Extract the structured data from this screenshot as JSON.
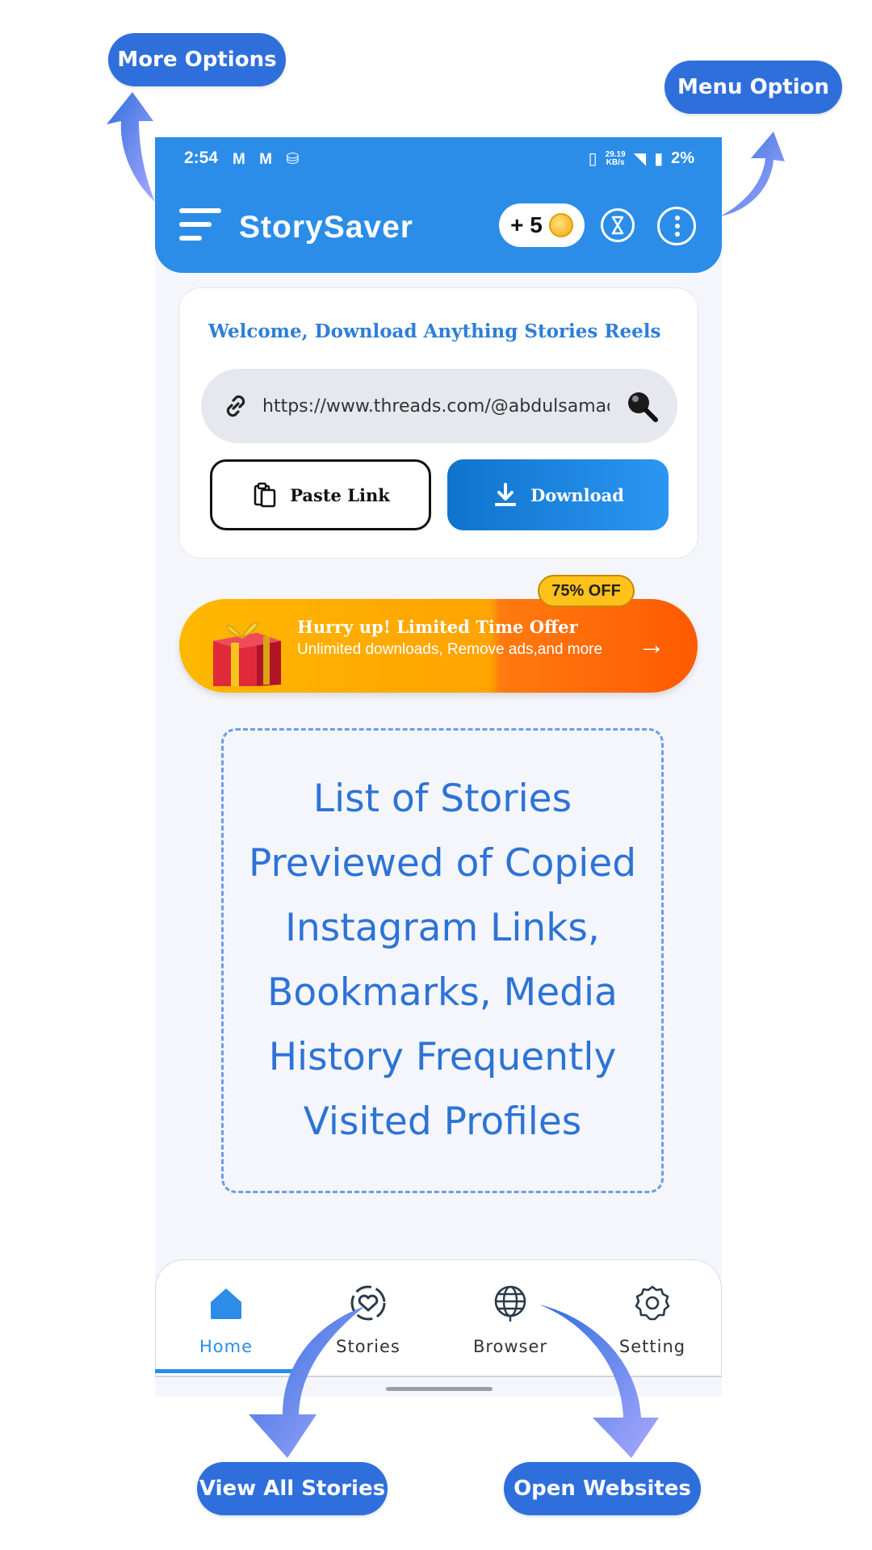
{
  "callouts": {
    "more_options": "More Options",
    "menu_option": "Menu Option",
    "view_all_stories": "View All Stories",
    "open_websites": "Open Websites"
  },
  "status_bar": {
    "time": "2:54",
    "net_speed_value": "29.19",
    "net_speed_unit": "KB/s",
    "battery": "2%"
  },
  "app_bar": {
    "title": "StorySaver",
    "coins": "+ 5"
  },
  "welcome_card": {
    "heading": "Welcome, Download Anything Stories Reels",
    "url_value": "https://www.threads.com/@abdulsamadn?s",
    "paste_label": "Paste Link",
    "download_label": "Download"
  },
  "promo": {
    "badge": "75% OFF",
    "title": "Hurry up! Limited Time Offer",
    "subtitle": "Unlimited downloads, Remove ads,and more"
  },
  "placeholder_text": "List of Stories Previewed of Copied Instagram Links, Bookmarks, Media History Frequently Visited Profiles",
  "bottom_nav": {
    "home": "Home",
    "stories": "Stories",
    "browser": "Browser",
    "setting": "Setting"
  },
  "colors": {
    "primary": "#2b8de8",
    "callout": "#2f6fdc",
    "promo_start": "#ffb800",
    "promo_end": "#ff5a00"
  }
}
